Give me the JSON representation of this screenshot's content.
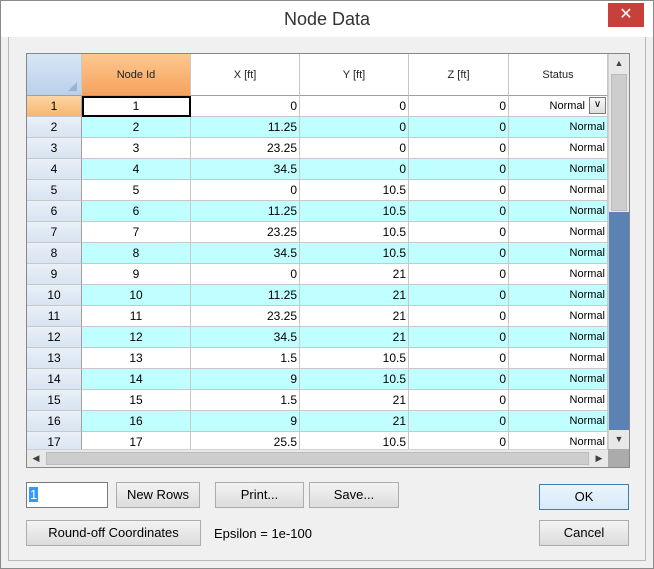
{
  "window": {
    "title": "Node Data",
    "close_glyph": "✕"
  },
  "columns": [
    "Node Id",
    "X [ft]",
    "Y [ft]",
    "Z [ft]",
    "Status"
  ],
  "rows": [
    [
      "1",
      "1",
      "0",
      "0",
      "0",
      "Normal"
    ],
    [
      "2",
      "2",
      "11.25",
      "0",
      "0",
      "Normal"
    ],
    [
      "3",
      "3",
      "23.25",
      "0",
      "0",
      "Normal"
    ],
    [
      "4",
      "4",
      "34.5",
      "0",
      "0",
      "Normal"
    ],
    [
      "5",
      "5",
      "0",
      "10.5",
      "0",
      "Normal"
    ],
    [
      "6",
      "6",
      "11.25",
      "10.5",
      "0",
      "Normal"
    ],
    [
      "7",
      "7",
      "23.25",
      "10.5",
      "0",
      "Normal"
    ],
    [
      "8",
      "8",
      "34.5",
      "10.5",
      "0",
      "Normal"
    ],
    [
      "9",
      "9",
      "0",
      "21",
      "0",
      "Normal"
    ],
    [
      "10",
      "10",
      "11.25",
      "21",
      "0",
      "Normal"
    ],
    [
      "11",
      "11",
      "23.25",
      "21",
      "0",
      "Normal"
    ],
    [
      "12",
      "12",
      "34.5",
      "21",
      "0",
      "Normal"
    ],
    [
      "13",
      "13",
      "1.5",
      "10.5",
      "0",
      "Normal"
    ],
    [
      "14",
      "14",
      "9",
      "10.5",
      "0",
      "Normal"
    ],
    [
      "15",
      "15",
      "1.5",
      "21",
      "0",
      "Normal"
    ],
    [
      "16",
      "16",
      "9",
      "21",
      "0",
      "Normal"
    ],
    [
      "17",
      "17",
      "25.5",
      "10.5",
      "0",
      "Normal"
    ]
  ],
  "rows_input": {
    "value": "1"
  },
  "buttons": {
    "new_rows": "New Rows",
    "print": "Print...",
    "save": "Save...",
    "ok": "OK",
    "round_off": "Round-off Coordinates",
    "cancel": "Cancel"
  },
  "epsilon_text": "Epsilon = 1e-100",
  "colors": {
    "alt_row": "#c0ffff",
    "active_header": "#f7a25b",
    "scroll_track": "#5b82b3"
  }
}
